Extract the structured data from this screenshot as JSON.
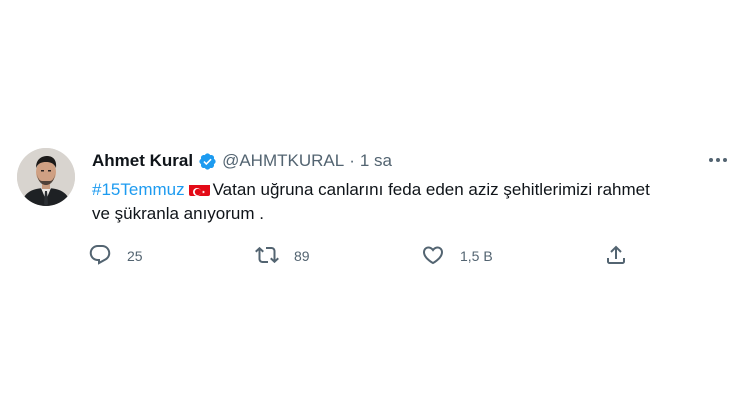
{
  "tweet": {
    "author_name": "Ahmet Kural",
    "handle": "@AHMTKURAL",
    "separator": "·",
    "time": "1 sa",
    "hashtag": "#15Temmuz",
    "flag_icon": "turkish-flag-icon",
    "body_line1": "Vatan uğruna canlarını feda eden aziz şehitlerimizi rahmet",
    "body_line2": "ve şükranla anıyorum ."
  },
  "actions": {
    "reply_count": "25",
    "retweet_count": "89",
    "like_count": "1,5 B"
  },
  "colors": {
    "verified": "#1d9bf0",
    "hashtag": "#1d9bf0",
    "muted_text": "#536471",
    "flag_red": "#e30a17"
  }
}
